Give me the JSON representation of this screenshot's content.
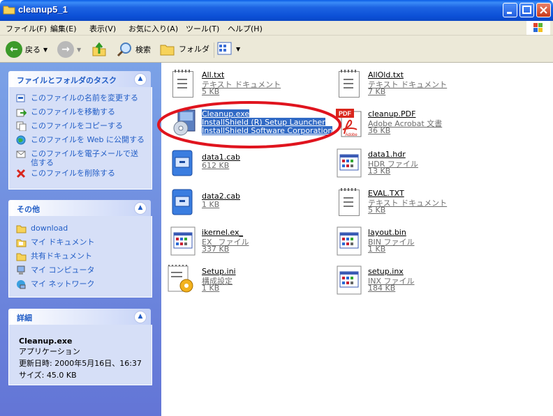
{
  "window": {
    "title": "cleanup5_1"
  },
  "menu": [
    "ファイル(F)",
    "編集(E)",
    "表示(V)",
    "お気に入り(A)",
    "ツール(T)",
    "ヘルプ(H)"
  ],
  "toolbar": {
    "back": "戻る",
    "search": "検索",
    "folders": "フォルダ"
  },
  "tasks_panel": {
    "title": "ファイルとフォルダのタスク",
    "items": [
      "このファイルの名前を変更する",
      "このファイルを移動する",
      "このファイルをコピーする",
      "このファイルを Web に公開する",
      "このファイルを電子メールで送信する",
      "このファイルを削除する"
    ]
  },
  "other_panel": {
    "title": "その他",
    "items": [
      "download",
      "マイ ドキュメント",
      "共有ドキュメント",
      "マイ コンピュータ",
      "マイ ネットワーク"
    ]
  },
  "details_panel": {
    "title": "詳細",
    "name": "Cleanup.exe",
    "type": "アプリケーション",
    "modified": "更新日時: 2000年5月16日、16:37",
    "size": "サイズ: 45.0 KB"
  },
  "files": [
    {
      "name": "All.txt",
      "line2": "テキスト ドキュメント",
      "line3": "5 KB",
      "icon": "text-document-icon"
    },
    {
      "name": "AllOld.txt",
      "line2": "テキスト ドキュメント",
      "line3": "7 KB",
      "icon": "text-document-icon"
    },
    {
      "name": "Cleanup.exe",
      "line2": "InstallShield (R) Setup Launcher",
      "line3": "InstallShield Software Corporation",
      "icon": "installer-icon",
      "selected": true
    },
    {
      "name": "cleanup.PDF",
      "line2": "Adobe Acrobat 文書",
      "line3": "36 KB",
      "icon": "pdf-icon"
    },
    {
      "name": "data1.cab",
      "line2": "612 KB",
      "line3": "",
      "icon": "cabinet-icon"
    },
    {
      "name": "data1.hdr",
      "line2": "HDR ファイル",
      "line3": "13 KB",
      "icon": "generic-file-icon"
    },
    {
      "name": "data2.cab",
      "line2": "1 KB",
      "line3": "",
      "icon": "cabinet-icon"
    },
    {
      "name": "EVAL.TXT",
      "line2": "テキスト ドキュメント",
      "line3": "5 KB",
      "icon": "text-document-icon"
    },
    {
      "name": "ikernel.ex_",
      "line2": "EX_ ファイル",
      "line3": "337 KB",
      "icon": "generic-file-icon"
    },
    {
      "name": "layout.bin",
      "line2": "BIN ファイル",
      "line3": "1 KB",
      "icon": "generic-file-icon"
    },
    {
      "name": "Setup.ini",
      "line2": "構成設定",
      "line3": "1 KB",
      "icon": "config-file-icon"
    },
    {
      "name": "setup.inx",
      "line2": "INX ファイル",
      "line3": "184 KB",
      "icon": "generic-file-icon"
    }
  ],
  "colors": {
    "titlebar": "#0a5ce6",
    "taskpane": "#6f8fe0",
    "selection": "#316ac5",
    "annotation": "#e0141e"
  }
}
